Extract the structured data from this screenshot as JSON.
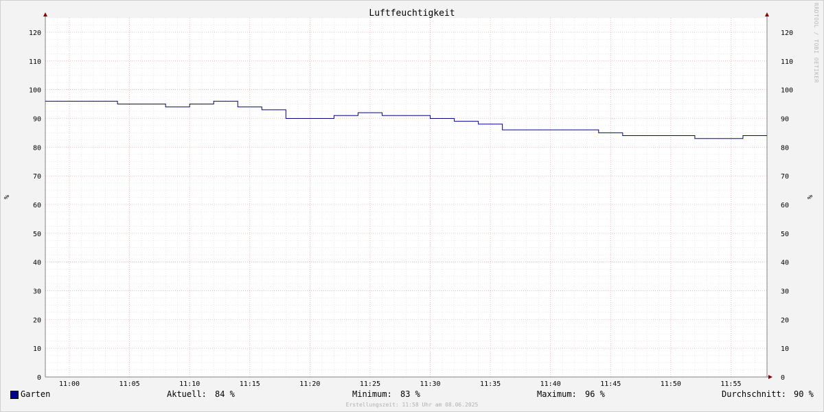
{
  "chart_data": {
    "type": "line",
    "title": "Luftfeuchtigkeit",
    "ylabel_left": "%",
    "ylabel_right": "%",
    "ylim": [
      0,
      125
    ],
    "yticks": [
      0,
      10,
      20,
      30,
      40,
      50,
      60,
      70,
      80,
      90,
      100,
      110,
      120
    ],
    "xlim": [
      "10:58",
      "11:58"
    ],
    "xticks": [
      "11:00",
      "11:05",
      "11:10",
      "11:15",
      "11:20",
      "11:25",
      "11:30",
      "11:35",
      "11:40",
      "11:45",
      "11:50",
      "11:55"
    ],
    "grid": true,
    "series": [
      {
        "name": "Garten",
        "color": "#00008b",
        "x": [
          "10:58",
          "11:04",
          "11:08",
          "11:10",
          "11:12",
          "11:14",
          "11:16",
          "11:18",
          "11:22",
          "11:24",
          "11:26",
          "11:30",
          "11:32",
          "11:34",
          "11:36",
          "11:38",
          "11:44",
          "11:46",
          "11:52",
          "11:56",
          "11:58"
        ],
        "values": [
          96,
          95,
          94,
          95,
          96,
          94,
          93,
          90,
          91,
          92,
          91,
          90,
          89,
          88,
          86,
          86,
          85,
          84,
          83,
          84,
          84
        ]
      }
    ]
  },
  "legend": {
    "series_name": "Garten",
    "current_label": "Aktuell:",
    "current_value": "84 %",
    "min_label": "Minimum:",
    "min_value": "83 %",
    "max_label": "Maximum:",
    "max_value": "96 %",
    "avg_label": "Durchschnitt:",
    "avg_value": "90 %"
  },
  "footer": "Erstellungszeit: 11:58 Uhr am 08.06.2025",
  "watermark": "RRDTOOL / TOBI OETIKER"
}
